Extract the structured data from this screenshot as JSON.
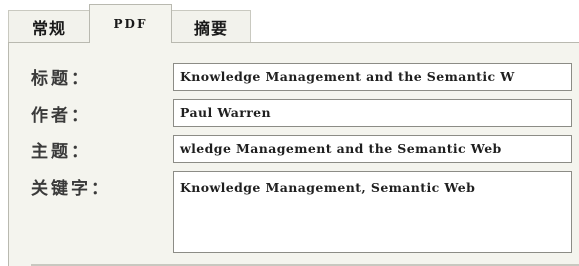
{
  "tabs": [
    {
      "label": "常规"
    },
    {
      "label": "PDF"
    },
    {
      "label": "摘要"
    }
  ],
  "active_tab": "PDF",
  "fields": {
    "title": {
      "label": "标题：",
      "value": "Knowledge Management and the Semantic W"
    },
    "author": {
      "label": "作者：",
      "value": "Paul Warren"
    },
    "subject": {
      "label": "主题：",
      "value": "wledge Management and the Semantic Web"
    },
    "keywords": {
      "label": "关键字：",
      "value": "Knowledge Management, Semantic Web"
    }
  }
}
